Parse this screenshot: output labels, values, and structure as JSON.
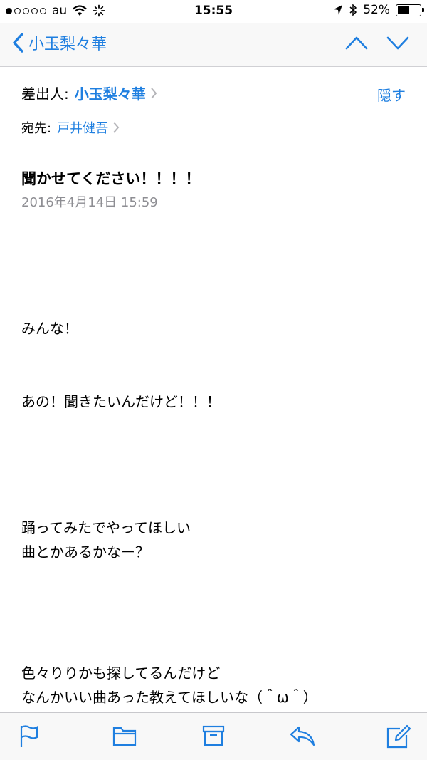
{
  "status_bar": {
    "carrier": "au",
    "time": "15:55",
    "battery": "52%",
    "battery_level": 0.52
  },
  "nav": {
    "back_label": "小玉梨々華"
  },
  "header": {
    "from_label": "差出人:",
    "from_name": "小玉梨々華",
    "hide_label": "隠す",
    "to_label": "宛先:",
    "to_name": "戸井健吾",
    "subject": "聞かせてください！！！！",
    "date": "2016年4月14日 15:59"
  },
  "body": {
    "lines": [
      "みんな！",
      "あの！聞きたいんだけど！！！",
      "踊ってみたでやってほしい",
      "曲とかあるかなー？",
      "色々りりかも探してるんだけど",
      "なんかいい曲あった教えてほしいな（＾ω＾）"
    ]
  },
  "colors": {
    "accent": "#1f7fe0",
    "secondary_text": "#8e8e93"
  },
  "icons": {
    "back": "chevron-left-icon",
    "prev": "chevron-up-icon",
    "next": "chevron-down-icon",
    "flag": "flag-icon",
    "folder": "folder-icon",
    "archive": "archive-icon",
    "reply": "reply-icon",
    "compose": "compose-icon"
  }
}
